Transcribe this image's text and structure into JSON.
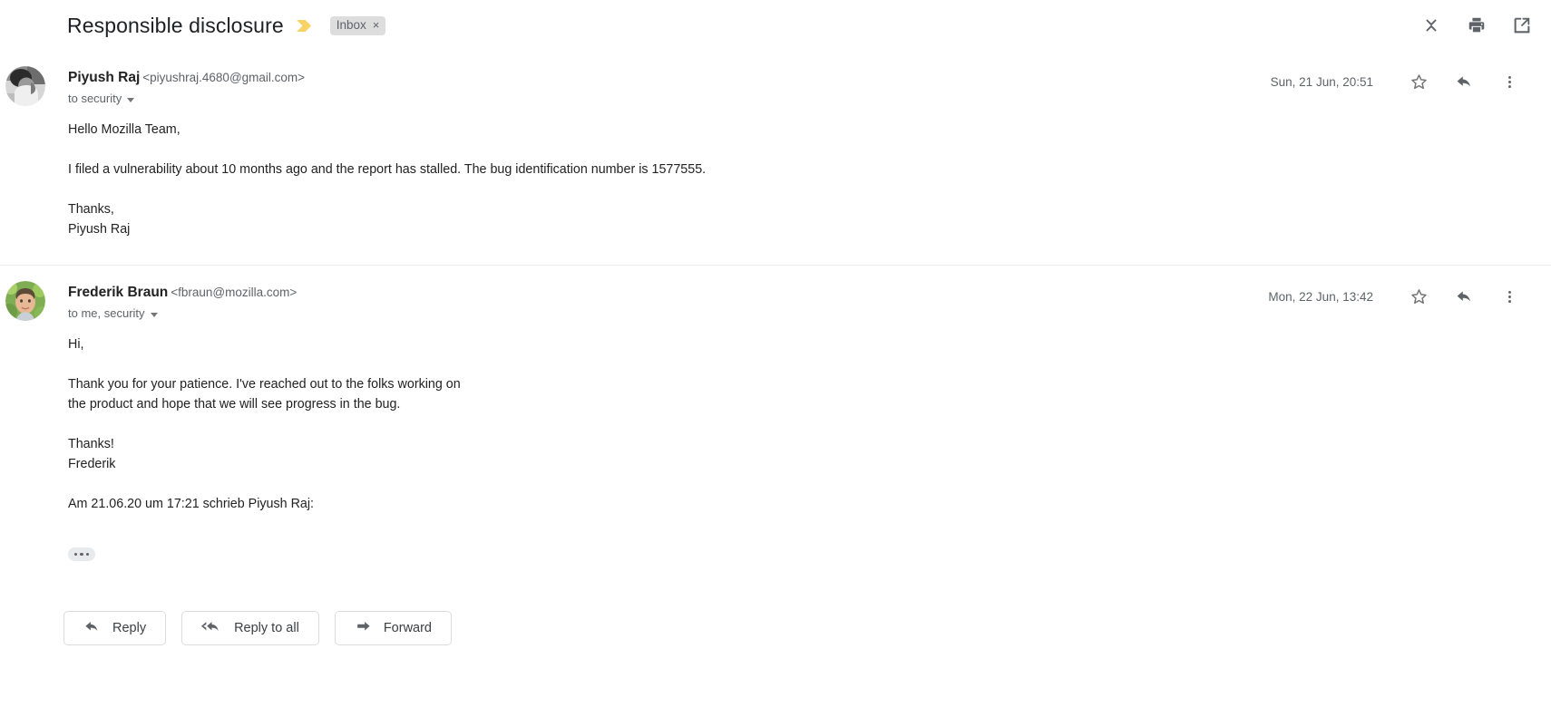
{
  "thread": {
    "title": "Responsible disclosure",
    "important_marker_icon": "important-chevron-icon",
    "important_marker_color": "#f8d265",
    "label": {
      "name": "Inbox",
      "remove": "×"
    }
  },
  "header_actions": [
    {
      "name": "collapse-all-icon",
      "label": "Collapse all"
    },
    {
      "name": "print-all-icon",
      "label": "Print all"
    },
    {
      "name": "open-in-new-window-icon",
      "label": "Open in new window"
    }
  ],
  "messages": [
    {
      "sender_name": "Piyush Raj",
      "sender_email": "<piyushraj.4680@gmail.com>",
      "recipients": "to security",
      "date": "Sun, 21 Jun, 20:51",
      "avatar": "photo-grayscale",
      "paragraphs": [
        "Hello Mozilla Team,",
        "I filed a vulnerability about 10 months ago and the report has stalled. The bug identification number is 1577555.",
        "",
        "Thanks,\nPiyush Raj"
      ],
      "actions": [
        {
          "name": "star-icon",
          "label": "Star"
        },
        {
          "name": "reply-icon",
          "label": "Reply"
        },
        {
          "name": "more-options-icon",
          "label": "More"
        }
      ]
    },
    {
      "sender_name": "Frederik Braun",
      "sender_email": "<fbraun@mozilla.com>",
      "recipients": "to me, security",
      "date": "Mon, 22 Jun, 13:42",
      "avatar": "photo-color",
      "paragraphs": [
        "Hi,",
        "Thank you for your patience. I've reached out to the folks working on\nthe product and hope that we will see progress in the bug.",
        "Thanks!\nFrederik"
      ],
      "quote_intro": "Am 21.06.20 um 17:21 schrieb Piyush Raj:",
      "expand_quoted_label": "Show trimmed content",
      "actions": [
        {
          "name": "star-icon",
          "label": "Star"
        },
        {
          "name": "reply-icon",
          "label": "Reply"
        },
        {
          "name": "more-options-icon",
          "label": "More"
        }
      ]
    }
  ],
  "footer_actions": [
    {
      "label": "Reply",
      "icon": "reply-arrow-icon"
    },
    {
      "label": "Reply to all",
      "icon": "reply-all-arrow-icon"
    },
    {
      "label": "Forward",
      "icon": "forward-arrow-icon"
    }
  ]
}
